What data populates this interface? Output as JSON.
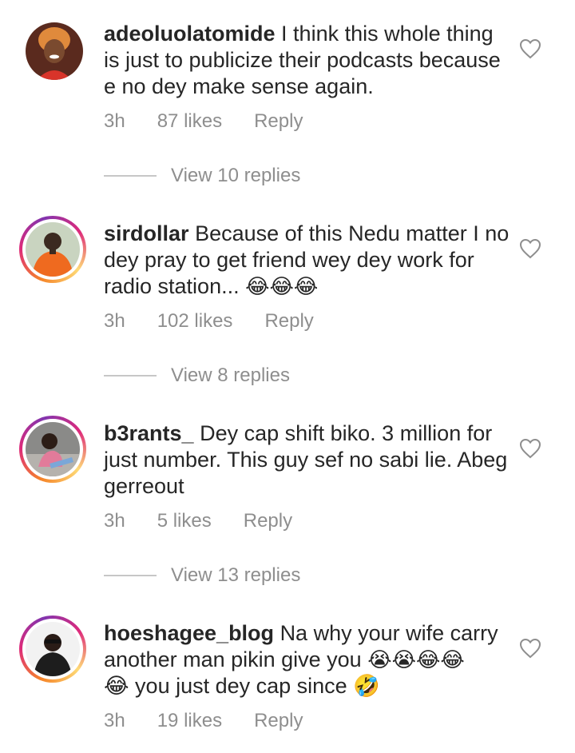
{
  "comments": [
    {
      "username": "adeoluolatomide",
      "text": "I think this whole thing is just to publicize their podcasts because e no dey make sense again.",
      "emojis": "",
      "time": "3h",
      "likes": "87 likes",
      "reply": "Reply",
      "view_replies": "View 10 replies",
      "has_story_ring": false
    },
    {
      "username": "sirdollar",
      "text": "Because of this Nedu matter I no dey pray to get friend wey dey work for radio station...",
      "emojis": "😂😂😂",
      "time": "3h",
      "likes": "102 likes",
      "reply": "Reply",
      "view_replies": "View 8 replies",
      "has_story_ring": true
    },
    {
      "username": "b3rants_",
      "text": "Dey cap shift biko. 3 million for just number. This guy sef no sabi lie. Abeg gerreout",
      "emojis": "",
      "time": "3h",
      "likes": "5 likes",
      "reply": "Reply",
      "view_replies": "View 13 replies",
      "has_story_ring": true
    },
    {
      "username": "hoeshagee_blog",
      "text": "Na why your wife carry another man pikin give you",
      "emojis": "😭😭😂😂",
      "text2": "😂 you just dey cap since 🤣",
      "time": "3h",
      "likes": "19 likes",
      "reply": "Reply",
      "has_story_ring": true
    }
  ],
  "icons": {
    "like": "heart-outline-icon"
  },
  "colors": {
    "text": "#262626",
    "muted": "#8e8e8e",
    "divider": "#c7c7c7"
  }
}
